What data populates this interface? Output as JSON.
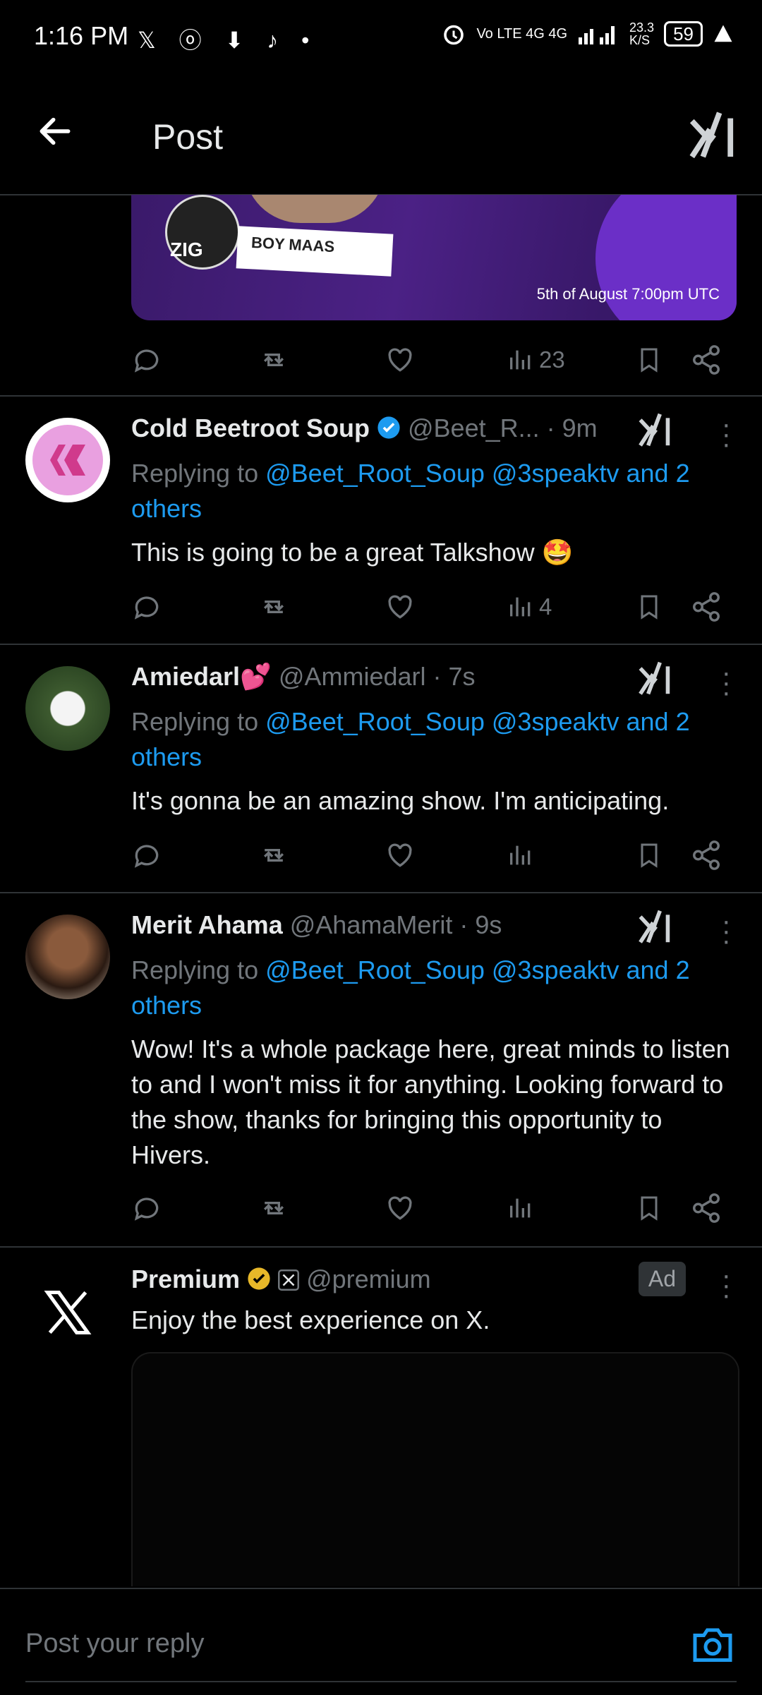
{
  "status_bar": {
    "time": "1:16 PM",
    "notif_icons": "𝕏 ⓞ ⬇ ♪ •",
    "net_rate": "23.3\nK/S",
    "battery": "59",
    "signal": "Vo LTE 4G 4G"
  },
  "header": {
    "title": "Post"
  },
  "banner": {
    "name_plate": "BOY MAAS",
    "brand": "ZIG",
    "date": "5th of August 7:00pm UTC",
    "views": "23"
  },
  "replies": [
    {
      "name": "Cold Beetroot Soup",
      "handle": "@Beet_R...",
      "time": "· 9m",
      "replying_prefix": "Replying to ",
      "mentions": "@Beet_Root_Soup @3speaktv and 2",
      "mentions2": "others",
      "text": "This is going to be a great Talkshow 🤩",
      "views": "4"
    },
    {
      "name": "Amiedarl💕",
      "handle": "@Ammiedarl",
      "time": "· 7s",
      "replying_prefix": "Replying to ",
      "mentions": "@Beet_Root_Soup @3speaktv and 2",
      "mentions2": "others",
      "text": "It's gonna be an amazing show. I'm anticipating.",
      "views": ""
    },
    {
      "name": "Merit Ahama",
      "handle": "@AhamaMerit",
      "time": "· 9s",
      "replying_prefix": "Replying to ",
      "mentions": "@Beet_Root_Soup @3speaktv and 2",
      "mentions2": "others",
      "text": "Wow! It's a whole package here, great minds to listen to and I won't miss it for anything. Looking forward to the show, thanks for bringing this opportunity to Hivers.",
      "views": ""
    }
  ],
  "ad": {
    "name": "Premium",
    "handle": "@premium",
    "badge": "Ad",
    "text": "Enjoy the best experience on X."
  },
  "composer": {
    "placeholder": "Post your reply"
  },
  "colors": {
    "accent": "#1d9bf0",
    "muted": "#71767b",
    "gold": "#e8b829"
  }
}
